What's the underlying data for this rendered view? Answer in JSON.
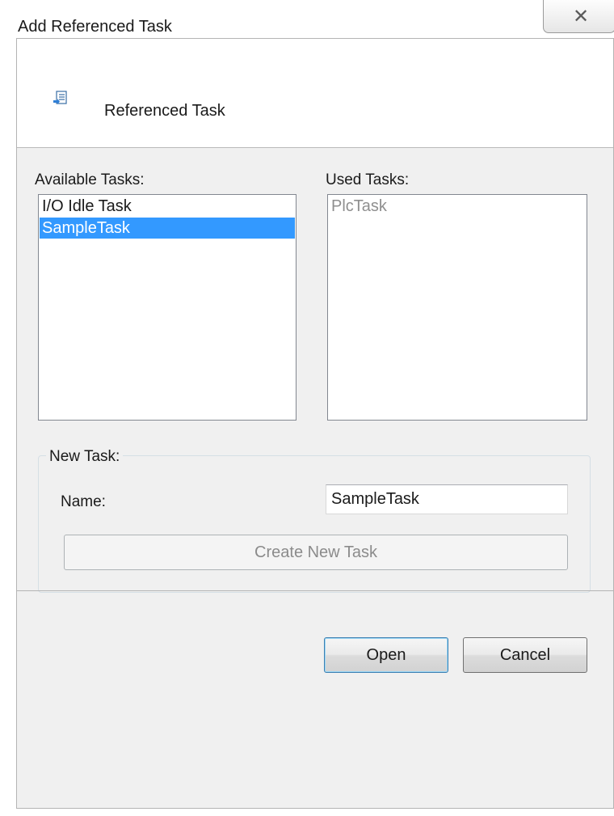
{
  "window": {
    "title": "Add Referenced Task",
    "close_glyph": "✕"
  },
  "header": {
    "icon": "referenced-task-icon",
    "text": "Referenced Task"
  },
  "available_tasks": {
    "label": "Available Tasks:",
    "items": [
      {
        "label": "I/O Idle Task",
        "selected": false
      },
      {
        "label": "SampleTask",
        "selected": true
      }
    ]
  },
  "used_tasks": {
    "label": "Used Tasks:",
    "items": [
      {
        "label": "PlcTask",
        "disabled": true
      }
    ]
  },
  "new_task": {
    "group_label": "New Task:",
    "name_label": "Name:",
    "name_value": "SampleTask",
    "create_button": "Create New Task"
  },
  "footer": {
    "open_button": "Open",
    "cancel_button": "Cancel"
  },
  "colors": {
    "selection": "#3399ff",
    "background": "#f0f0f0"
  }
}
